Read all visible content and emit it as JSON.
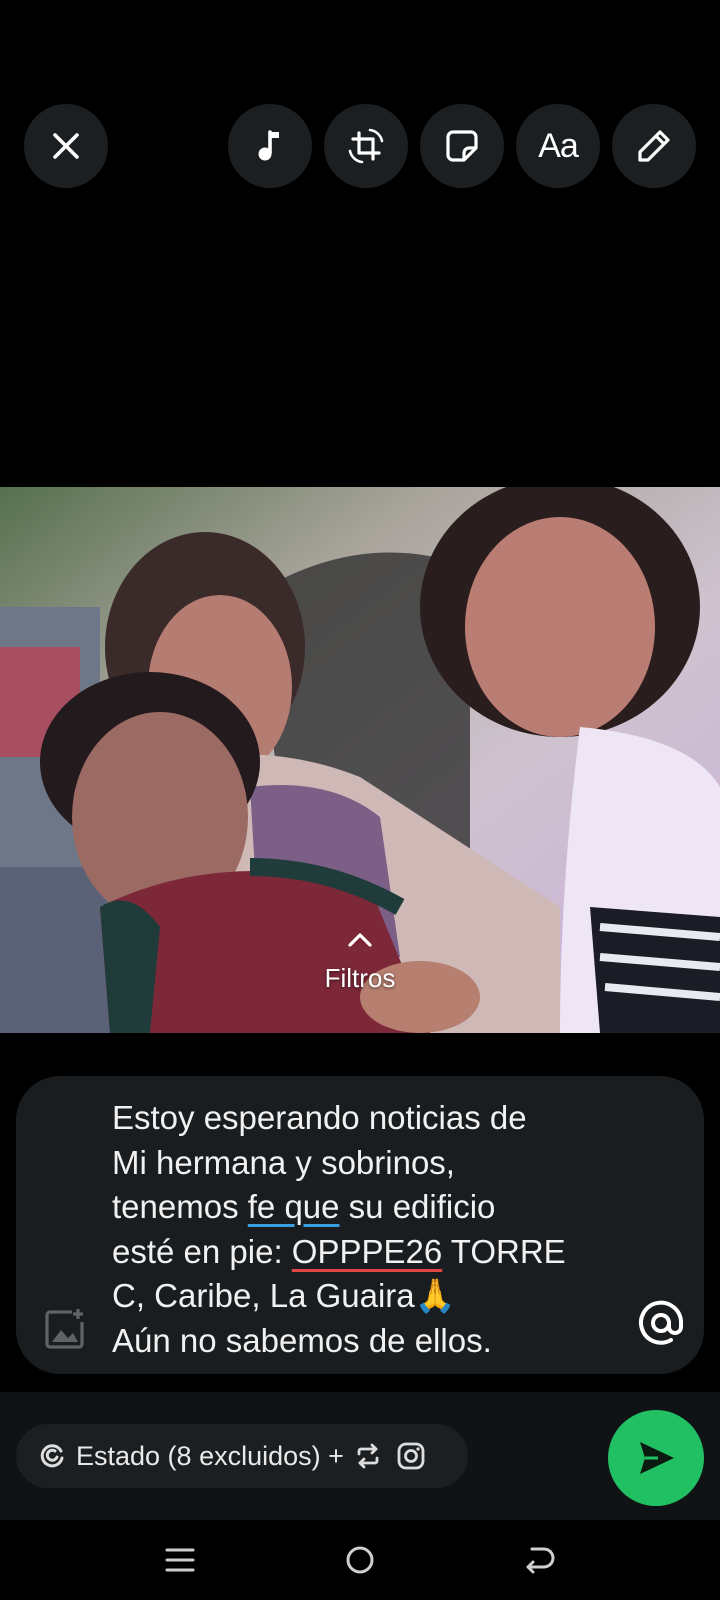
{
  "toolbar": {
    "close_icon": "close-icon",
    "music_icon": "music-note-icon",
    "crop_icon": "crop-rotate-icon",
    "sticker_icon": "sticker-icon",
    "text_label": "Aa",
    "draw_icon": "pencil-icon"
  },
  "photo": {
    "filters_label": "Filtros"
  },
  "caption": {
    "lines": [
      "Estoy esperando noticias de",
      "Mi hermana y sobrinos,",
      "tenemos ",
      "fe que",
      " su edificio",
      "esté en pie: ",
      "OPPPE26",
      " TORRE",
      "C, Caribe, La Guaira",
      "🙏",
      "Aún no sabemos de ellos."
    ]
  },
  "status": {
    "label": "Estado (8 excluidos) +"
  },
  "colors": {
    "accent_green": "#21c063",
    "panel": "#1a1d1f",
    "spell_blue": "#3aa0e0",
    "spell_red": "#e04646"
  }
}
